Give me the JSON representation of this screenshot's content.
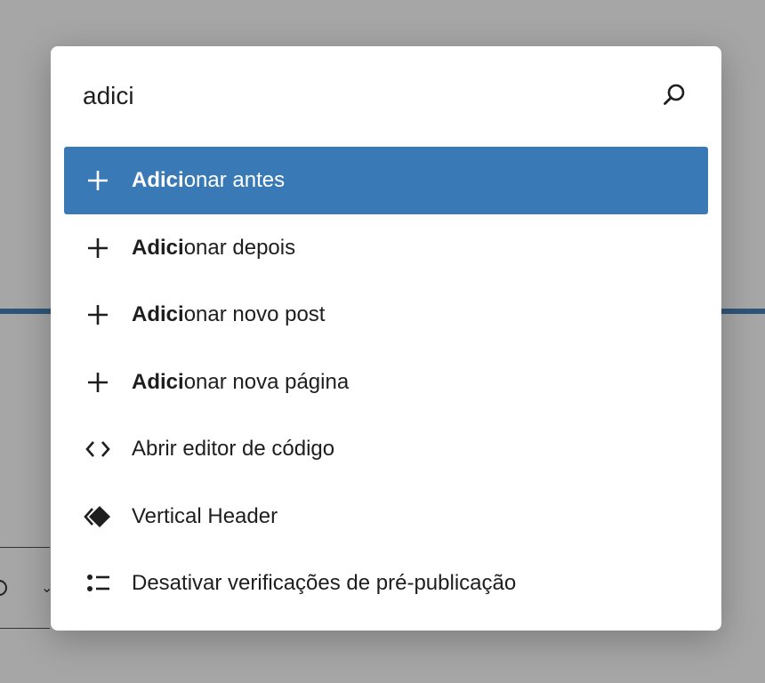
{
  "search": {
    "value": "adici",
    "icon": "search-icon"
  },
  "results": [
    {
      "highlight": "Adici",
      "rest": "onar antes",
      "icon": "plus-icon",
      "active": true
    },
    {
      "highlight": "Adici",
      "rest": "onar depois",
      "icon": "plus-icon",
      "active": false
    },
    {
      "highlight": "Adici",
      "rest": "onar novo post",
      "icon": "plus-icon",
      "active": false
    },
    {
      "highlight": "Adici",
      "rest": "onar nova página",
      "icon": "plus-icon",
      "active": false
    },
    {
      "highlight": "",
      "rest": "Abrir editor de código",
      "icon": "code-icon",
      "active": false
    },
    {
      "highlight": "",
      "rest": "Vertical Header",
      "icon": "template-part-icon",
      "active": false
    },
    {
      "highlight": "",
      "rest": "Desativar verificações de pré-publicação",
      "icon": "list-check-icon",
      "active": false
    }
  ],
  "colors": {
    "overlay": "#a6a6a6",
    "accent": "#3979b5",
    "text": "#1e1e1e"
  }
}
